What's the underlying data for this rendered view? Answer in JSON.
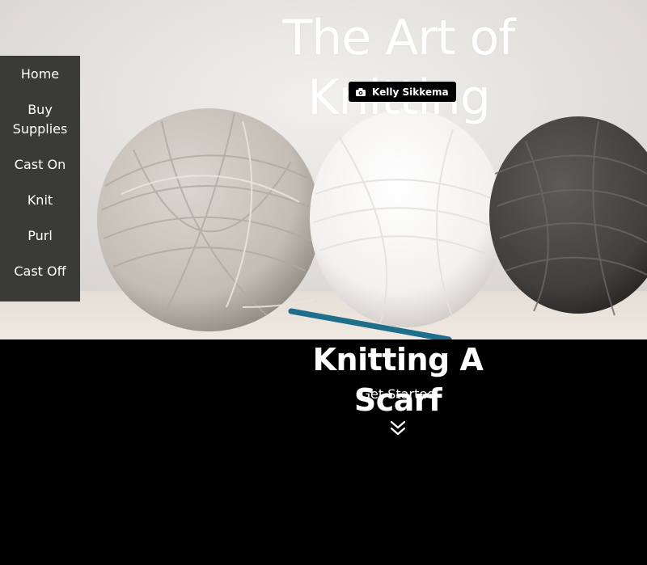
{
  "header": {
    "title": "The Art of Knitting",
    "photo_credit": "Kelly Sikkema",
    "camera_icon": "camera-icon"
  },
  "sidebar": {
    "items": [
      {
        "label": "Home"
      },
      {
        "label": "Buy Supplies"
      },
      {
        "label": "Cast On"
      },
      {
        "label": "Knit"
      },
      {
        "label": "Purl"
      },
      {
        "label": "Cast Off"
      }
    ]
  },
  "main": {
    "heading": "Knitting A Scarf",
    "cta": "Get Started",
    "scroll_icon": "double-chevron-down-icon"
  },
  "colors": {
    "sidebar_bg": "#3a3a39",
    "page_bg": "#000000",
    "text": "#ffffff"
  }
}
